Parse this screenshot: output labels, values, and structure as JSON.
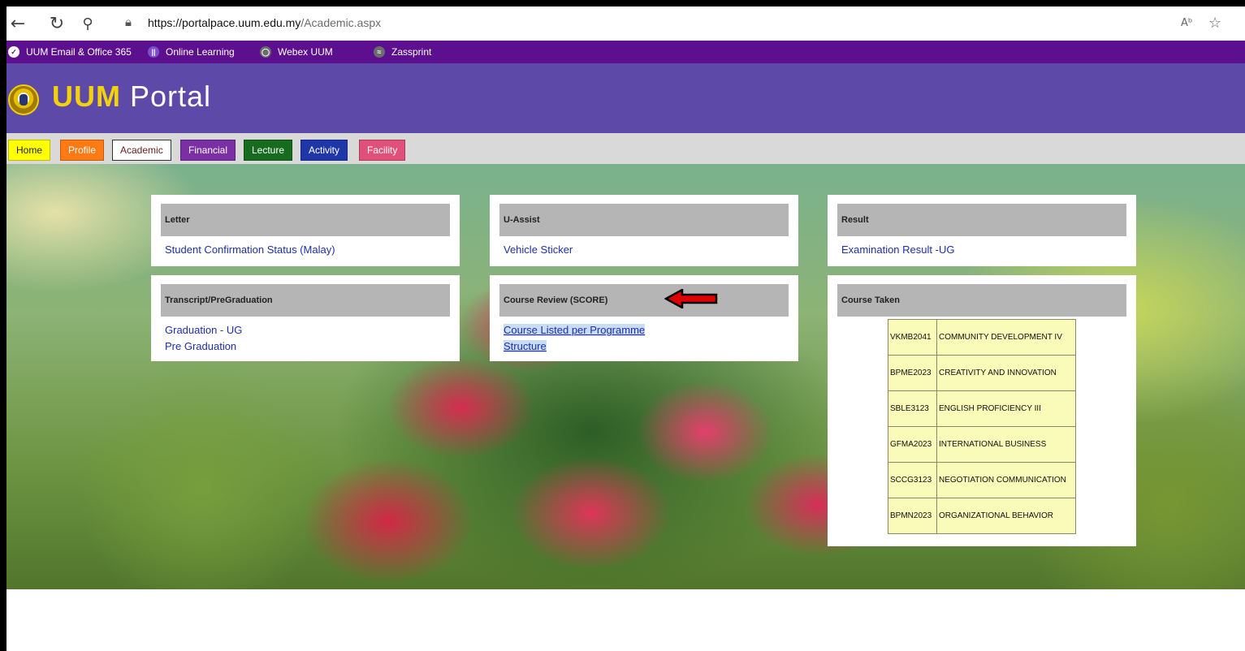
{
  "browser": {
    "url_domain": "https://portalpace.uum.edu.my",
    "url_path": "/Academic.aspx",
    "icons": [
      "back-icon",
      "refresh-icon",
      "search-icon",
      "lock-icon",
      "read-aloud-icon",
      "favorite-star-icon"
    ]
  },
  "bookmarks": [
    {
      "label": "UUM Email & Office 365",
      "icon": "email-icon",
      "color": "#ffffff"
    },
    {
      "label": "Online Learning",
      "icon": "online-learning-icon",
      "color": "#7b4fd0"
    },
    {
      "label": "Webex UUM",
      "icon": "webex-icon",
      "color": "#6c6c6c"
    },
    {
      "label": "Zassprint",
      "icon": "zassprint-icon",
      "color": "#6c6c6c"
    }
  ],
  "header": {
    "logo_bold": "UUM",
    "logo_rest": "Portal",
    "accent": "#f3d20c",
    "background": "#5d49a8"
  },
  "menu": [
    {
      "label": "Home",
      "bg": "#ffff00",
      "fg": "#222222"
    },
    {
      "label": "Profile",
      "bg": "#ff7a12",
      "fg": "#ffffff"
    },
    {
      "label": "Academic",
      "bg": "#ffffff",
      "fg": "#6b1c1c"
    },
    {
      "label": "Financial",
      "bg": "#7b2fa5",
      "fg": "#ffffff"
    },
    {
      "label": "Lecture",
      "bg": "#166b1e",
      "fg": "#ffffff"
    },
    {
      "label": "Activity",
      "bg": "#1e36a8",
      "fg": "#ffffff"
    },
    {
      "label": "Facility",
      "bg": "#e0507a",
      "fg": "#ffffff"
    }
  ],
  "panels": {
    "letter": {
      "title": "Letter",
      "links": [
        "Student Confirmation Status (Malay)"
      ]
    },
    "u_assist": {
      "title": "U-Assist",
      "links": [
        "Vehicle Sticker"
      ]
    },
    "result": {
      "title": "Result",
      "links": [
        "Examination Result -UG"
      ]
    },
    "transcript": {
      "title": "Transcript/PreGraduation",
      "links": [
        "Graduation - UG",
        "Pre Graduation"
      ]
    },
    "course_review": {
      "title": "Course Review (SCORE)",
      "link_line1": "Course Listed per Programme",
      "link_line2": "Structure"
    },
    "course_taken": {
      "title": "Course Taken"
    }
  },
  "courses": [
    {
      "code": "VKMB2041",
      "title": "COMMUNITY DEVELOPMENT IV"
    },
    {
      "code": "BPME2023",
      "title": "CREATIVITY AND INNOVATION"
    },
    {
      "code": "SBLE3123",
      "title": "ENGLISH PROFICIENCY III"
    },
    {
      "code": "GFMA2023",
      "title": "INTERNATIONAL BUSINESS"
    },
    {
      "code": "SCCG3123",
      "title": "NEGOTIATION COMMUNICATION"
    },
    {
      "code": "BPMN2023",
      "title": "ORGANIZATIONAL BEHAVIOR"
    }
  ],
  "annotation": {
    "arrow_color": "#e00000"
  }
}
